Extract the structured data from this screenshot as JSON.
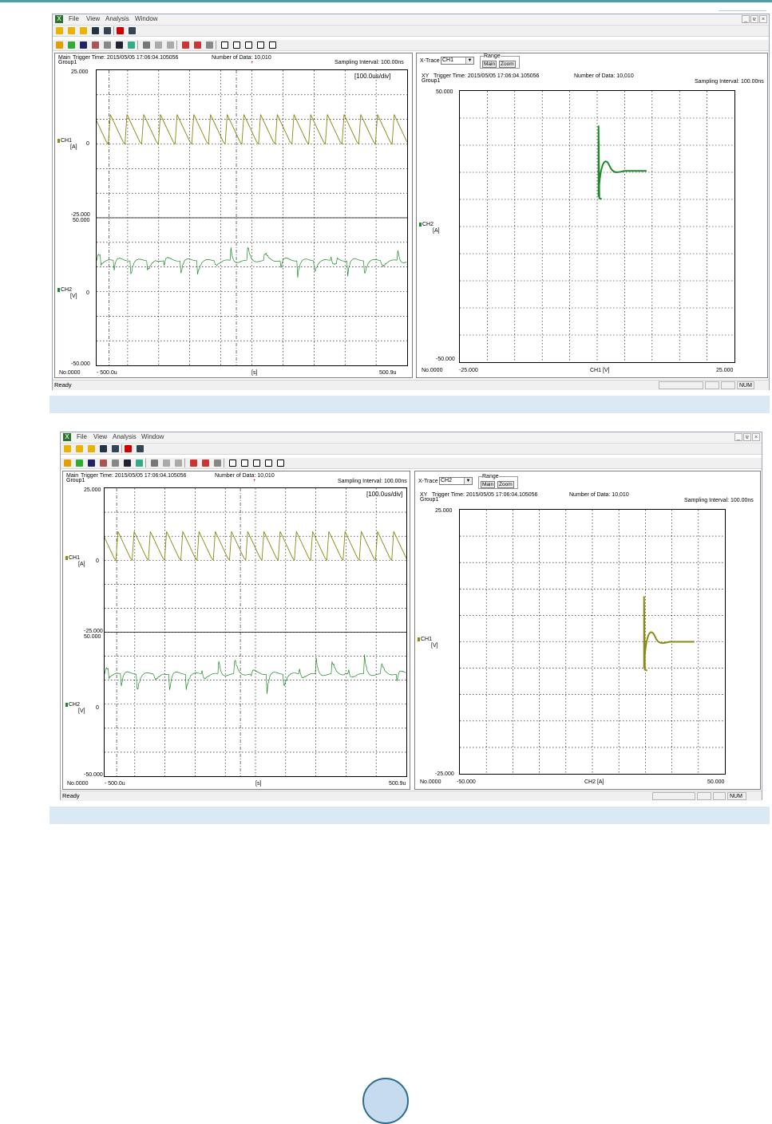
{
  "menu": [
    "File",
    "View",
    "Analysis",
    "Window"
  ],
  "window_buttons": [
    "_",
    "ɐ",
    "×"
  ],
  "status_ready": "Ready",
  "status_num": "NUM",
  "colors": {
    "ch1": "#8a8a14",
    "ch2": "#1c8a28",
    "caption_bar": "#dbe9f4",
    "top_rule": "#4f9ba6"
  },
  "shots": [
    {
      "waveform": {
        "mode": "Main",
        "group": "Group1",
        "trigger_time": "Trigger Time: 2015/05/05 17:06:04.105056",
        "number_of_data": "Number of Data: 10,010",
        "sampling_interval": "Sampling Interval:  100.00ns",
        "timebase": "[100.0us/div]",
        "ch1": {
          "name": "CH1",
          "unit": "[A]",
          "top": "25.000",
          "zero": "0",
          "bottom": "-25.000"
        },
        "ch2": {
          "name": "CH2",
          "unit": "[V]",
          "top": "50.000",
          "zero": "0",
          "bottom": "-50.000"
        },
        "x_start": "- 500.0u",
        "x_unit": "[s]",
        "x_end": "500.9u",
        "record_no": "No.0000"
      },
      "xy": {
        "xtrace_label": "X-Trace",
        "xtrace_value": "CH1",
        "range_label": "Range",
        "range_main": "Main",
        "range_zoom": "Zoom",
        "mode": "XY",
        "group": "Group1",
        "trigger_time": "Trigger Time: 2015/05/05 17:06:04.105056",
        "number_of_data": "Number of Data: 10,010",
        "sampling_interval": "Sampling Interval:  100.00ns",
        "y_top": "50.000",
        "y_bottom": "-50.000",
        "y_channel": "CH2",
        "y_unit": "[A]",
        "x_left": "-25.000",
        "x_label": "CH1  [V]",
        "x_right": "25.000",
        "record_no": "No.0000"
      }
    },
    {
      "waveform": {
        "mode": "Main",
        "group": "Group1",
        "trigger_time": "Trigger Time: 2015/05/05 17:06:04.105056",
        "number_of_data": "Number of Data: 10,010",
        "sampling_interval": "Sampling Interval:  100.00ns",
        "timebase": "[100.0us/div]",
        "ch1": {
          "name": "CH1",
          "unit": "[A]",
          "top": "25.000",
          "zero": "0",
          "bottom": "-25.000"
        },
        "ch2": {
          "name": "CH2",
          "unit": "[V]",
          "top": "50.000",
          "zero": "0",
          "bottom": "-50.000"
        },
        "x_start": "- 500.0u",
        "x_unit": "[s]",
        "x_end": "500.9u",
        "record_no": "No.0000"
      },
      "xy": {
        "xtrace_label": "X-Trace",
        "xtrace_value": "CH2",
        "range_label": "Range",
        "range_main": "Main",
        "range_zoom": "Zoom",
        "mode": "XY",
        "group": "Group1",
        "trigger_time": "Trigger Time: 2015/05/05 17:06:04.105056",
        "number_of_data": "Number of Data: 10,010",
        "sampling_interval": "Sampling Interval:  100.00ns",
        "y_top": "25.000",
        "y_bottom": "-25.000",
        "y_channel": "CH1",
        "y_unit": "[V]",
        "x_left": "-50.000",
        "x_label": "CH2  [A]",
        "x_right": "50.000",
        "record_no": "No.0000"
      }
    }
  ]
}
